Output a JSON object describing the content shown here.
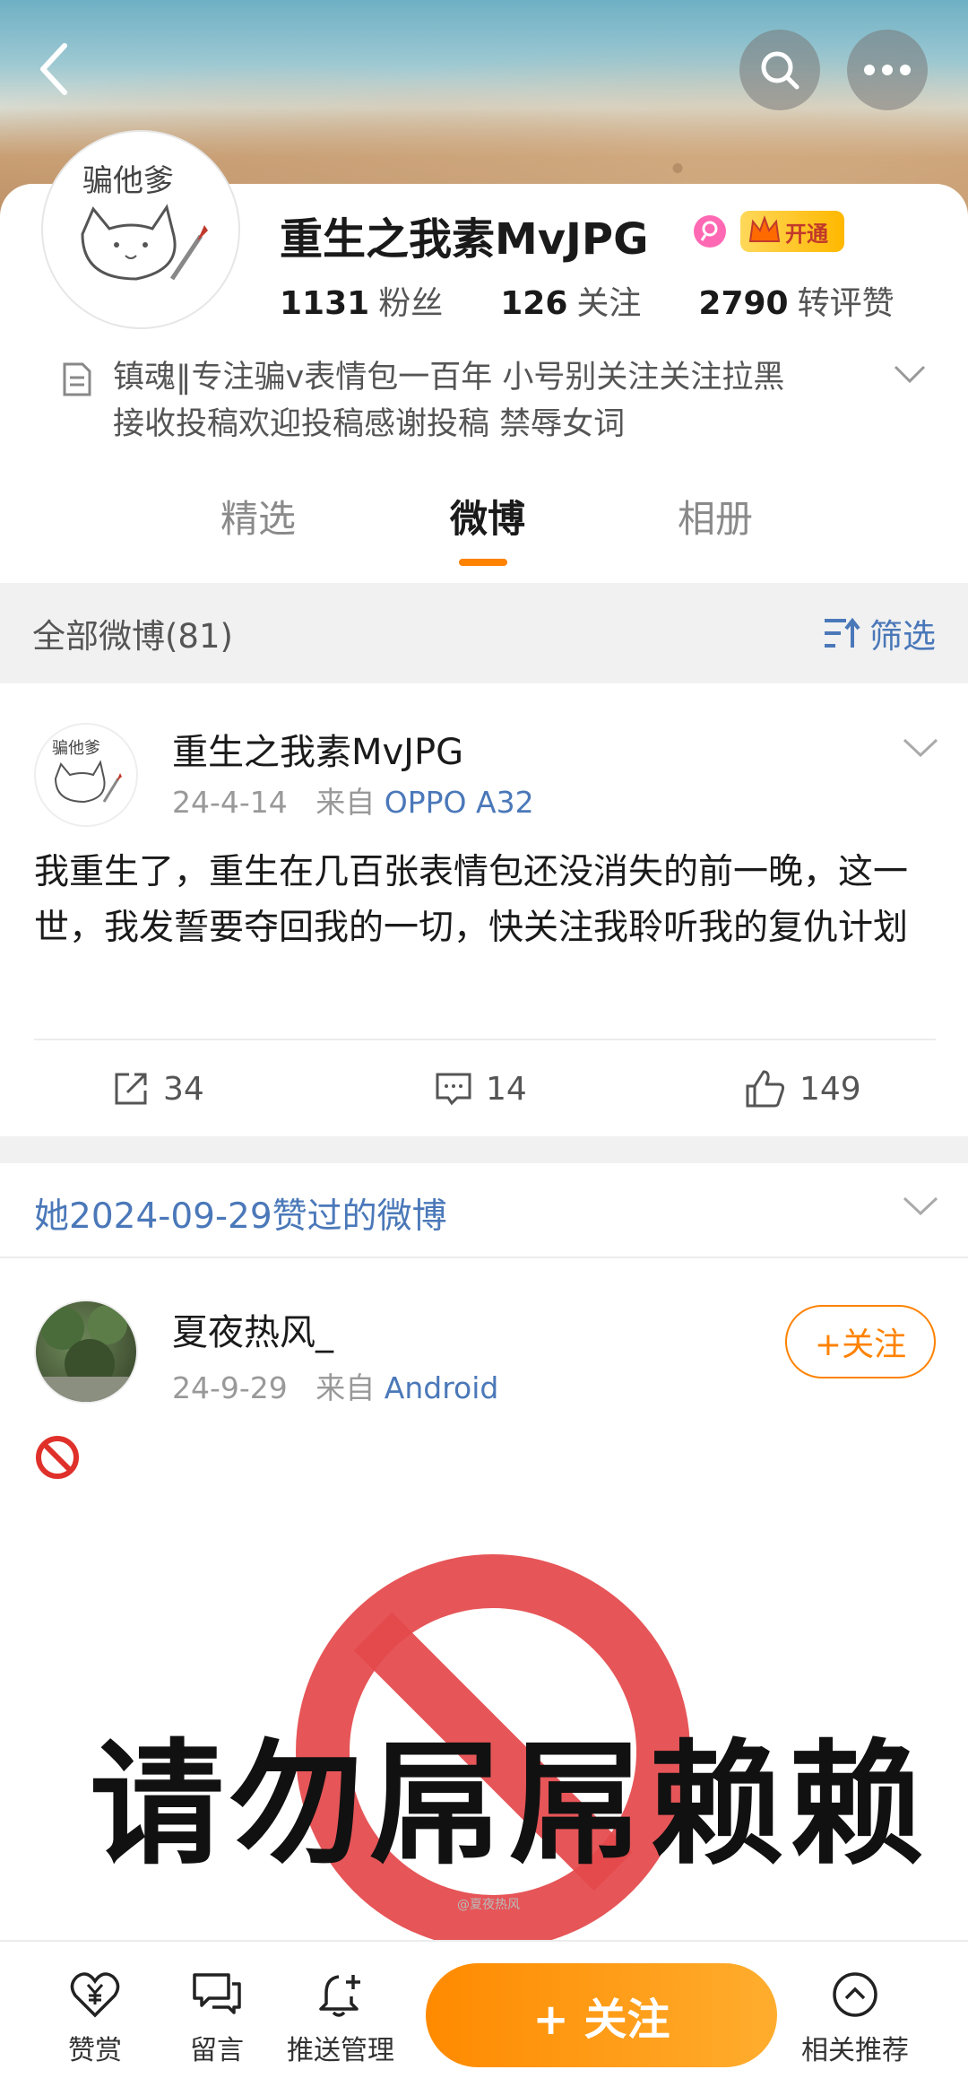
{
  "header": {
    "back_icon": "chevron-left-icon",
    "search_icon": "search-icon",
    "more_icon": "more-horizontal-icon"
  },
  "profile": {
    "avatar_text": "骗他爹",
    "name": "重生之我素MvJPG",
    "vip_label": "开通",
    "stats": [
      {
        "value": "1131",
        "label": "粉丝"
      },
      {
        "value": "126",
        "label": "关注"
      },
      {
        "value": "2790",
        "label": "转评赞"
      }
    ],
    "bio_line1": "镇魂‖专注骗v表情包一百年 小号别关注关注拉黑",
    "bio_line2": "接收投稿欢迎投稿感谢投稿 禁辱女词"
  },
  "tabs": [
    {
      "label": "精选",
      "active": false
    },
    {
      "label": "微博",
      "active": true
    },
    {
      "label": "相册",
      "active": false
    }
  ],
  "filter": {
    "count_label": "全部微博(81)",
    "sift_label": "筛选"
  },
  "post1": {
    "author": "重生之我素MvJPG",
    "date": "24-4-14",
    "from_label": "来自",
    "source": "OPPO A32",
    "text": "我重生了，重生在几百张表情包还没消失的前一晚，这一世，我发誓要夺回我的一切，快关注我聆听我的复仇计划",
    "reposts": "34",
    "comments": "14",
    "likes": "149"
  },
  "liked_header": "她2024-09-29赞过的微博",
  "post2": {
    "author": "夏夜热风_",
    "date": "24-9-29",
    "from_label": "来自",
    "source": "Android",
    "follow_label": "+关注",
    "meme_text": "请勿屌屌赖赖",
    "watermark": "@夏夜热风"
  },
  "bottom_bar": {
    "reward": "赞赏",
    "message": "留言",
    "push": "推送管理",
    "follow": "+ 关注",
    "recommend": "相关推荐"
  },
  "colors": {
    "accent_orange": "#ff8200",
    "link_blue": "#4a78b8"
  }
}
